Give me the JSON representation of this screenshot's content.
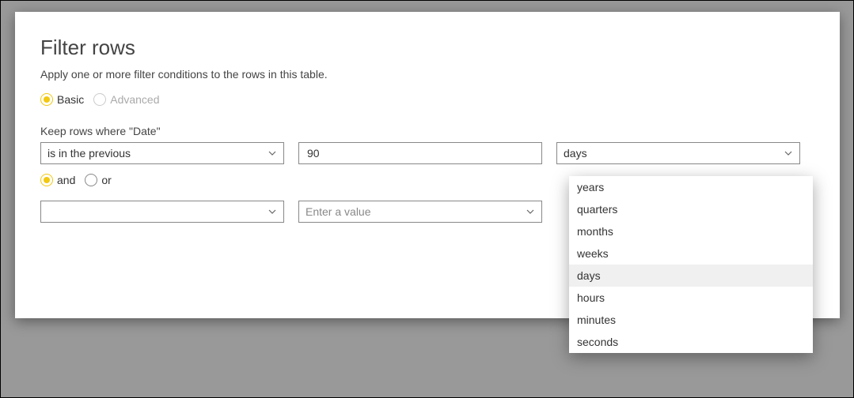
{
  "dialog": {
    "title": "Filter rows",
    "subtitle": "Apply one or more filter conditions to the rows in this table."
  },
  "mode": {
    "basic_label": "Basic",
    "advanced_label": "Advanced",
    "selected": "basic"
  },
  "keep_label": "Keep rows where \"Date\"",
  "row1": {
    "operator": "is in the previous",
    "value": "90",
    "unit": "days"
  },
  "logic": {
    "and_label": "and",
    "or_label": "or",
    "selected": "and"
  },
  "row2": {
    "operator": "",
    "value_placeholder": "Enter a value"
  },
  "unit_menu": {
    "options": [
      "years",
      "quarters",
      "months",
      "weeks",
      "days",
      "hours",
      "minutes",
      "seconds"
    ],
    "selected": "days"
  },
  "colors": {
    "accent": "#f2c811"
  }
}
